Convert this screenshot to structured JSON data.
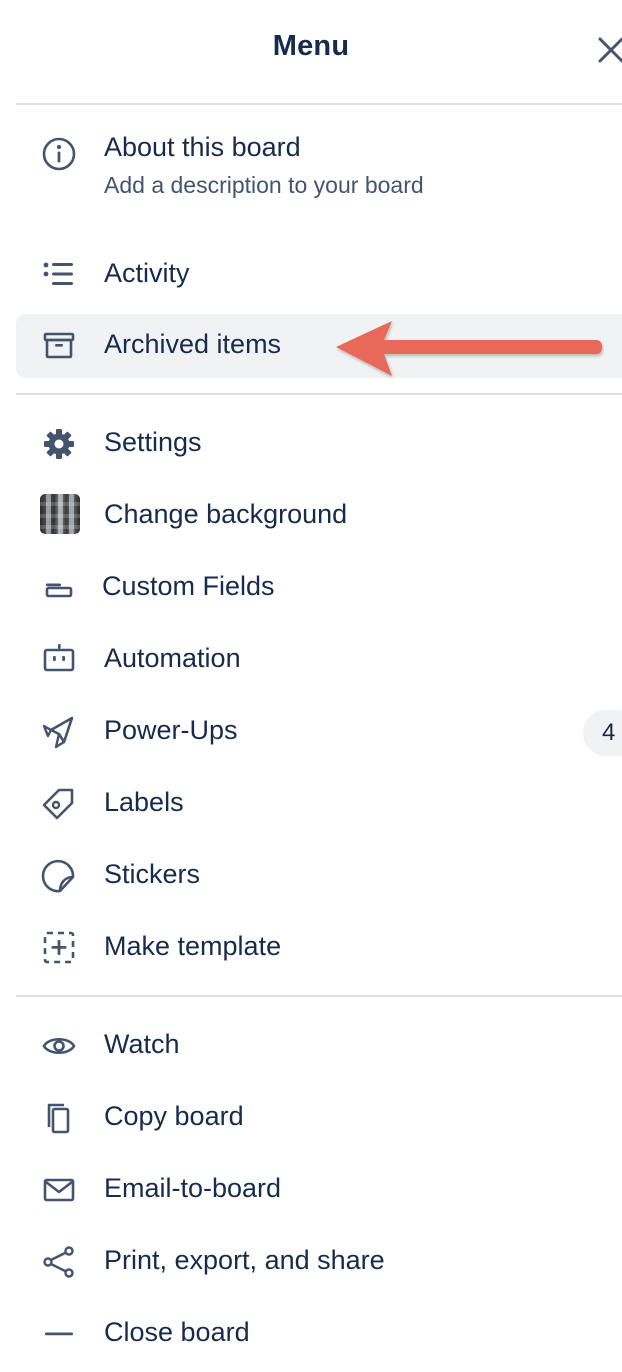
{
  "header": {
    "title": "Menu",
    "close_icon": "close-icon"
  },
  "sections": {
    "about": {
      "label": "About this board",
      "sublabel": "Add a description to your board",
      "icon": "info-icon"
    },
    "activity": {
      "label": "Activity",
      "icon": "activity-list-icon"
    },
    "archived": {
      "label": "Archived items",
      "icon": "archive-icon"
    },
    "settings": {
      "label": "Settings",
      "icon": "gear-icon"
    },
    "change_background": {
      "label": "Change background",
      "icon": "background-thumbnail"
    },
    "custom_fields": {
      "label": "Custom Fields",
      "icon": "custom-fields-icon"
    },
    "automation": {
      "label": "Automation",
      "icon": "robot-icon"
    },
    "power_ups": {
      "label": "Power-Ups",
      "icon": "rocket-icon",
      "badge": "4"
    },
    "labels": {
      "label": "Labels",
      "icon": "tag-icon"
    },
    "stickers": {
      "label": "Stickers",
      "icon": "sticker-icon"
    },
    "make_template": {
      "label": "Make template",
      "icon": "template-add-icon"
    },
    "watch": {
      "label": "Watch",
      "icon": "eye-icon"
    },
    "copy_board": {
      "label": "Copy board",
      "icon": "copy-icon"
    },
    "email_to_board": {
      "label": "Email-to-board",
      "icon": "envelope-icon"
    },
    "print_export_share": {
      "label": "Print, export, and share",
      "icon": "share-icon"
    },
    "close_board": {
      "label": "Close board",
      "icon": "minus-icon"
    }
  },
  "annotation": {
    "arrow_color": "#e8685a",
    "highlight_color": "#f1f2f4"
  }
}
